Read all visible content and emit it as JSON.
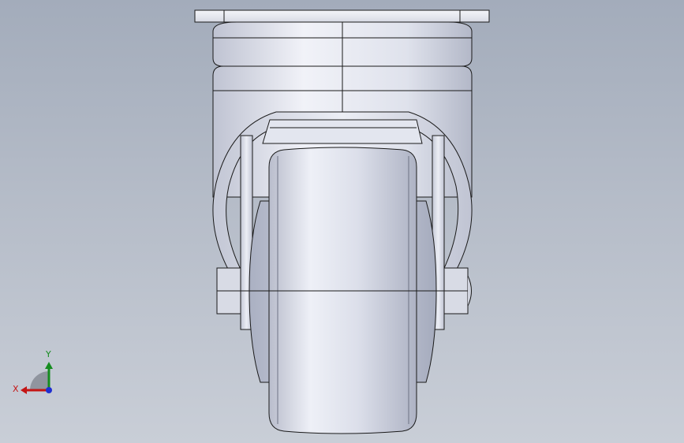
{
  "viewport": {
    "background_top": "#a3acbb",
    "background_bottom": "#c9ced7"
  },
  "model": {
    "name": "caster-wheel-front-view",
    "part_fill": "#dfe2ec",
    "part_shade": "#b4b9ca",
    "edge_color": "#1a1a1a"
  },
  "triad": {
    "x_label": "X",
    "y_label": "Y",
    "x_color": "#c41515",
    "y_color": "#158c1f",
    "z_color": "#1f2fd0"
  }
}
